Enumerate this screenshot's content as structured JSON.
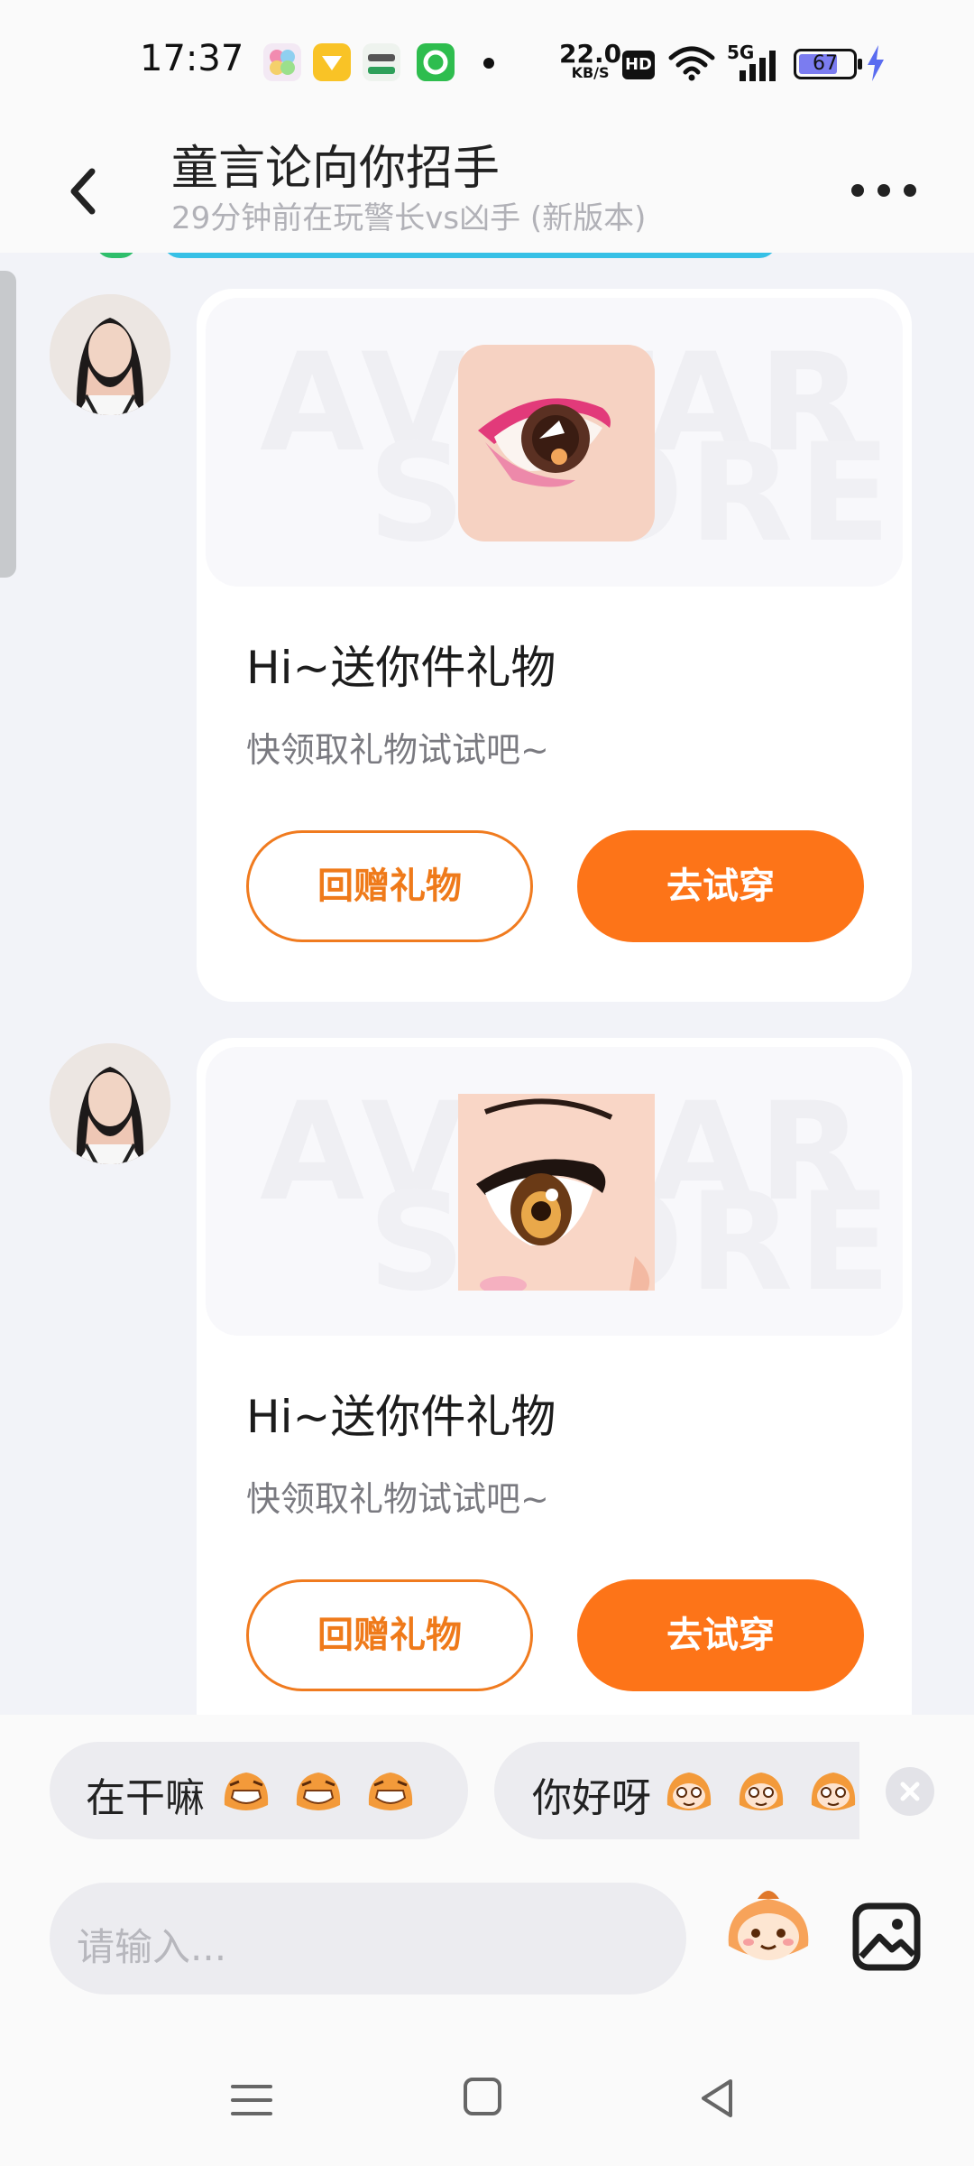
{
  "status_bar": {
    "time": "17:37",
    "net_speed": "22.0",
    "net_unit": "KB/S",
    "hd": "HD",
    "network": "5G",
    "battery": "67"
  },
  "header": {
    "title": "童言论向你招手",
    "subtitle": "29分钟前在玩警长vs凶手 (新版本)"
  },
  "messages": [
    {
      "watermark_line1": "AVATAR",
      "watermark_line2": "STORE",
      "title": "Hi~送你件礼物",
      "subtitle": "快领取礼物试试吧~",
      "return_gift_label": "回赠礼物",
      "try_on_label": "去试穿"
    },
    {
      "watermark_line1": "AVATAR",
      "watermark_line2": "STORE",
      "title": "Hi~送你件礼物",
      "subtitle": "快领取礼物试试吧~",
      "return_gift_label": "回赠礼物",
      "try_on_label": "去试穿"
    }
  ],
  "quick_replies": [
    "在干嘛",
    "你好呀"
  ],
  "input": {
    "placeholder": "请输入..."
  },
  "colors": {
    "accent": "#fd7418",
    "background": "#f2f3f8"
  }
}
